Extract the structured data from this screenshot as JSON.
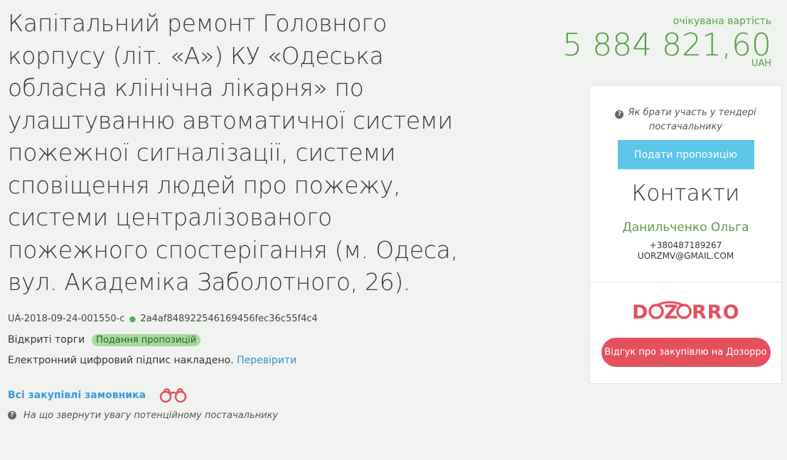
{
  "tender": {
    "title": "Капітальний ремонт Головного корпусу (літ. «А») КУ «Одеська обласна клінічна лікарня» по улаштуванню автоматичної системи пожежної сигналізації, системи сповіщення людей про пожежу, системи централізованого пожежного спостерігання (м. Одеса, вул. Академіка Заболотного, 26).",
    "id": "UA-2018-09-24-001550-c",
    "hash": "2a4af848922546169456fec36c55f4c4",
    "procedure": "Відкриті торги",
    "status": "Подання пропозицій",
    "signature_text": "Електронний цифровий підпис накладено.",
    "signature_link": "Перевірити",
    "all_purchases_link": "Всі закупівлі замовника",
    "hint": "На що звернути увагу потенційному постачальнику"
  },
  "price": {
    "label": "очікувана вартість",
    "value": "5 884 821,60",
    "currency": "UAH"
  },
  "card": {
    "how_to": "Як брати участь у тендері постачальнику",
    "submit_button": "Подати пропозицію",
    "contacts_title": "Контакти",
    "contact_name": "Данильченко Ольга",
    "contact_phone": "+380487189267",
    "contact_email": "UORZMV@GMAIL.COM",
    "dozorro_logo": "DOZORRO",
    "dozorro_button": "Відгук про закупівлю на Дозорро"
  },
  "colors": {
    "accent_green": "#5a9f4a",
    "link_blue": "#3a8cc9",
    "submit_blue": "#5bc6e8",
    "dozorro_red": "#e5505f",
    "status_badge_bg": "#a6dba0"
  }
}
